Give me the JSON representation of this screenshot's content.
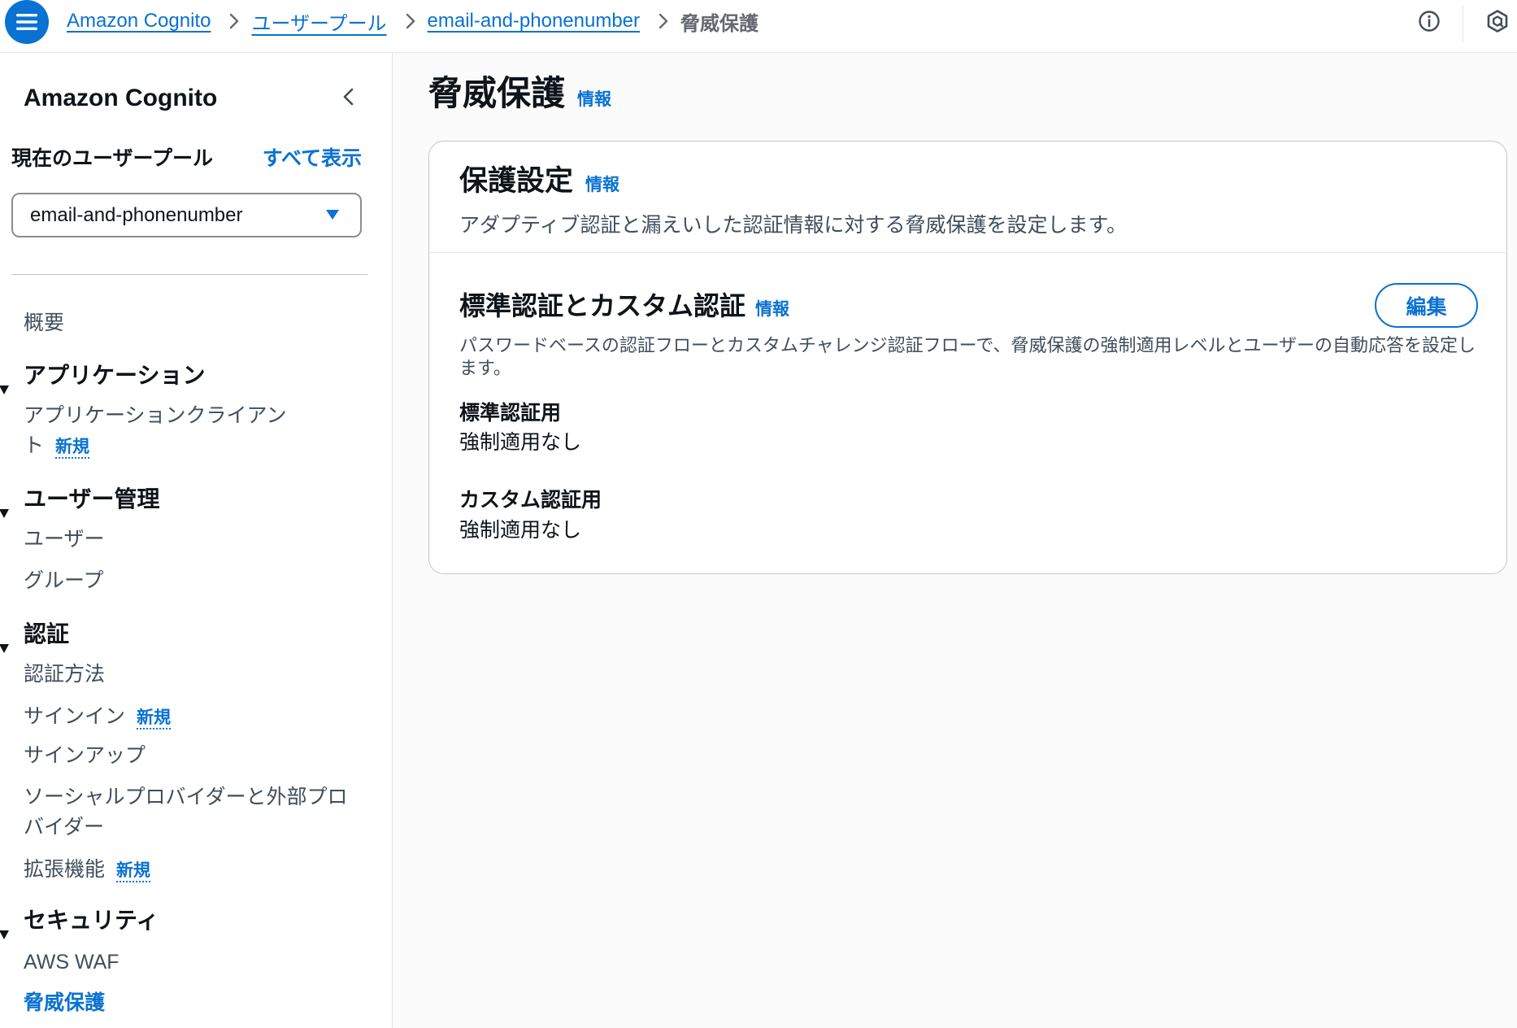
{
  "colors": {
    "accent": "#0972d3",
    "text": "#0f141a",
    "muted": "#414d5c",
    "border": "#c6c6cd"
  },
  "topbar": {
    "menu_icon": "hamburger-menu-icon",
    "separator_icon": "chevron-right-icon",
    "breadcrumbs": [
      {
        "label": "Amazon Cognito"
      },
      {
        "label": "ユーザープール"
      },
      {
        "label": "email-and-phonenumber"
      },
      {
        "label": "脅威保護"
      }
    ],
    "info_icon": "info-circle-icon",
    "assistant_icon": "amazon-q-icon"
  },
  "sidebar": {
    "title": "Amazon Cognito",
    "collapse_icon": "chevron-left-icon",
    "current_pool_label": "現在のユーザープール",
    "view_all_label": "すべて表示",
    "pool_select": {
      "value": "email-and-phonenumber",
      "icon": "caret-down-filled-icon"
    },
    "overview": "概要",
    "sections": [
      {
        "title": "アプリケーション",
        "items": [
          {
            "label": "アプリケーションクライアント",
            "badge": "新規"
          }
        ]
      },
      {
        "title": "ユーザー管理",
        "items": [
          {
            "label": "ユーザー"
          },
          {
            "label": "グループ"
          }
        ]
      },
      {
        "title": "認証",
        "items": [
          {
            "label": "認証方法"
          },
          {
            "label": "サインイン",
            "badge": "新規"
          },
          {
            "label": "サインアップ"
          },
          {
            "label": "ソーシャルプロバイダーと外部プロバイダー"
          },
          {
            "label": "拡張機能",
            "badge": "新規"
          }
        ]
      },
      {
        "title": "セキュリティ",
        "items": [
          {
            "label": "AWS WAF"
          },
          {
            "label": "脅威保護",
            "active": true
          }
        ]
      }
    ]
  },
  "main": {
    "title": "脅威保護",
    "info_label": "情報",
    "protection_settings": {
      "title": "保護設定",
      "info_label": "情報",
      "description": "アダプティブ認証と漏えいした認証情報に対する脅威保護を設定します。"
    },
    "standard_custom": {
      "title": "標準認証とカスタム認証",
      "info_label": "情報",
      "edit_label": "編集",
      "description": "パスワードベースの認証フローとカスタムチャレンジ認証フローで、脅威保護の強制適用レベルとユーザーの自動応答を設定します。",
      "fields": [
        {
          "label": "標準認証用",
          "value": "強制適用なし"
        },
        {
          "label": "カスタム認証用",
          "value": "強制適用なし"
        }
      ]
    }
  }
}
